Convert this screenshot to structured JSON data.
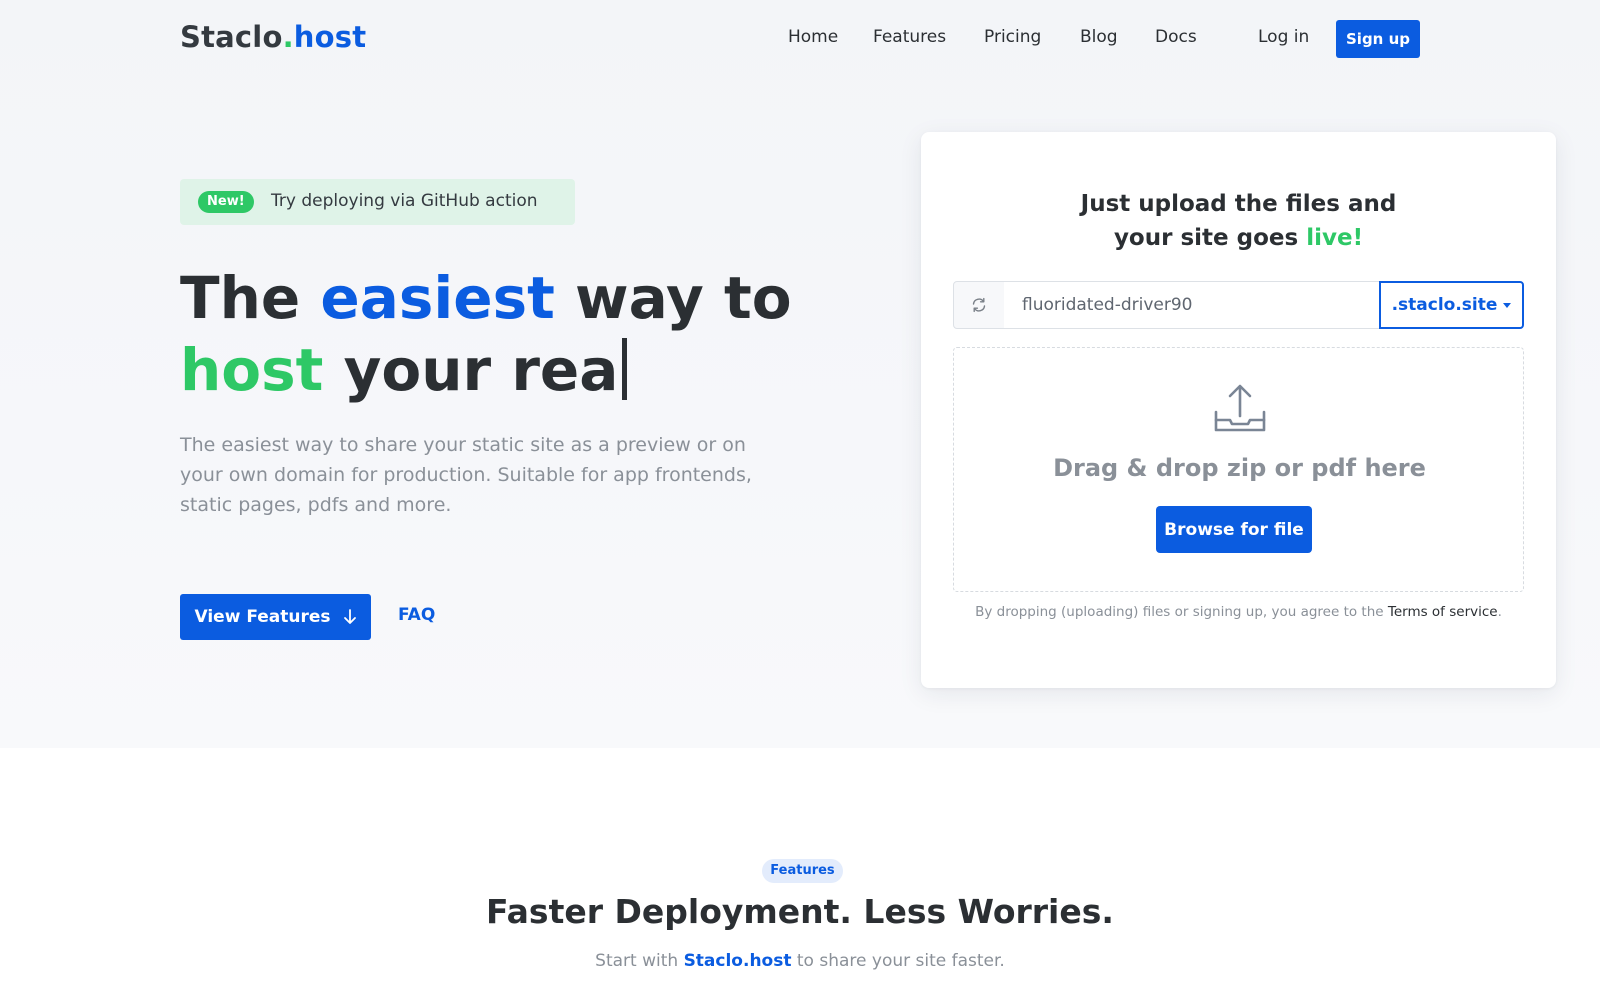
{
  "navbar": {
    "brand_part1": "Staclo",
    "brand_dot": ".",
    "brand_part2": "host",
    "links": [
      "Home",
      "Features",
      "Pricing",
      "Blog",
      "Docs"
    ],
    "login_label": "Log in",
    "signup_label": "Sign up"
  },
  "hero": {
    "badge_label": "New!",
    "badge_text": "Try deploying via GitHub action",
    "title_word1": "The ",
    "title_word2": "easiest",
    "title_word3": " way to",
    "title_word4": "host",
    "title_word5": " your rea",
    "description": "The easiest way to share your static site as a preview or on your own domain for production. Suitable for app frontends, static pages, pdfs and more.",
    "view_features_label": "View Features",
    "faq_label": "FAQ"
  },
  "upload_card": {
    "title_line1": "Just upload the files and",
    "title_line2_prefix": "your site goes ",
    "title_line2_highlight": "live!",
    "subdomain_value": "fluoridated-driver90",
    "domain_selected": ".staclo.site",
    "drop_text": "Drag & drop zip or pdf here",
    "browse_label": "Browse for file",
    "terms_prefix": "By dropping (uploading) files or signing up, you agree to the ",
    "terms_link": "Terms of service",
    "terms_suffix": "."
  },
  "features": {
    "pill_label": "Features",
    "heading": "Faster Deployment. Less Worries.",
    "sub_prefix": "Start with ",
    "sub_brand": "Staclo.host",
    "sub_suffix": " to share your site faster."
  },
  "colors": {
    "primary_blue": "#0b5ce0",
    "accent_green": "#2ec866",
    "text_dark": "#2b2f33",
    "text_muted": "#8a9098"
  },
  "icons": {
    "refresh": "refresh-icon",
    "upload": "upload-tray-icon",
    "arrow": "arrow-down-icon",
    "dropdown": "caret-down-icon"
  }
}
